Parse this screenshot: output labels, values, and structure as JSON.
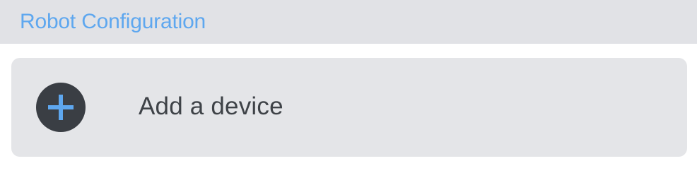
{
  "header": {
    "title": "Robot Configuration"
  },
  "device_card": {
    "label": "Add a device",
    "icon": "plus-icon"
  },
  "colors": {
    "accent": "#5ea7ef",
    "header_bg": "#e1e2e6",
    "card_bg": "#e4e5e8",
    "icon_bg": "#3a3e44",
    "text": "#3e4247"
  }
}
